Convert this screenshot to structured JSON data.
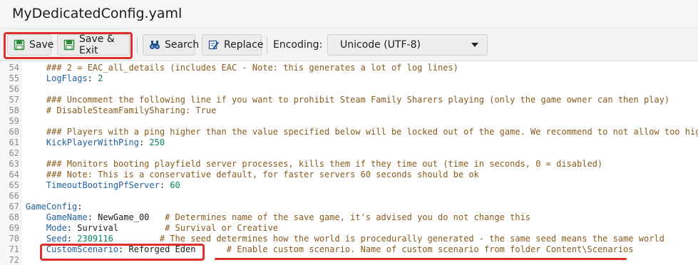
{
  "window": {
    "title": "MyDedicatedConfig.yaml"
  },
  "toolbar": {
    "save_label": "Save",
    "save_exit_label": "Save & Exit",
    "search_label": "Search",
    "replace_label": "Replace",
    "encoding_label": "Encoding:",
    "encoding_value": "Unicode (UTF-8)"
  },
  "colors": {
    "highlight": "#e0302e",
    "key": "#1f5f9f",
    "comment": "#8a5a1e",
    "number": "#098658"
  },
  "lines": [
    {
      "num": "54",
      "parts": [
        {
          "t": "    ### 2 = EAC_all_details (includes EAC - Note: this generates a lot of log lines)",
          "cls": "c"
        }
      ]
    },
    {
      "num": "55",
      "parts": [
        {
          "t": "    LogFlags",
          "cls": "k"
        },
        {
          "t": ": ",
          "cls": "s"
        },
        {
          "t": "2",
          "cls": "v"
        }
      ]
    },
    {
      "num": "56",
      "parts": []
    },
    {
      "num": "57",
      "parts": [
        {
          "t": "    ### Uncomment the following line if you want to prohibit Steam Family Sharers playing (only the game owner can then play)",
          "cls": "c"
        }
      ]
    },
    {
      "num": "58",
      "parts": [
        {
          "t": "    # DisableSteamFamilySharing: True",
          "cls": "c"
        }
      ]
    },
    {
      "num": "59",
      "parts": []
    },
    {
      "num": "60",
      "parts": [
        {
          "t": "    ### Players with a ping higher than the value specified below will be locked out of the game. We recommend to not allow too high",
          "cls": "c"
        }
      ]
    },
    {
      "num": "61",
      "parts": [
        {
          "t": "    KickPlayerWithPing",
          "cls": "k"
        },
        {
          "t": ": ",
          "cls": "s"
        },
        {
          "t": "250",
          "cls": "v"
        }
      ]
    },
    {
      "num": "62",
      "parts": []
    },
    {
      "num": "63",
      "parts": [
        {
          "t": "    ### Monitors booting playfield server processes, kills them if they time out (time in seconds, 0 = disabled)",
          "cls": "c"
        }
      ]
    },
    {
      "num": "64",
      "parts": [
        {
          "t": "    ### Note: This is a conservative default, for faster servers 60 seconds should be ok",
          "cls": "c"
        }
      ]
    },
    {
      "num": "65",
      "parts": [
        {
          "t": "    TimeoutBootingPfServer",
          "cls": "k"
        },
        {
          "t": ": ",
          "cls": "s"
        },
        {
          "t": "60",
          "cls": "v"
        }
      ]
    },
    {
      "num": "66",
      "parts": []
    },
    {
      "num": "67",
      "parts": [
        {
          "t": "GameConfig",
          "cls": "k"
        },
        {
          "t": ":",
          "cls": "s"
        }
      ]
    },
    {
      "num": "68",
      "parts": [
        {
          "t": "    GameName",
          "cls": "k"
        },
        {
          "t": ": NewGame_00   ",
          "cls": "s"
        },
        {
          "t": "# Determines name of the save game, it's advised you do not change this",
          "cls": "c"
        }
      ]
    },
    {
      "num": "69",
      "parts": [
        {
          "t": "    Mode",
          "cls": "k"
        },
        {
          "t": ": Survival         ",
          "cls": "s"
        },
        {
          "t": "# Survival or Creative",
          "cls": "c"
        }
      ]
    },
    {
      "num": "70",
      "parts": [
        {
          "t": "    Seed",
          "cls": "k"
        },
        {
          "t": ": ",
          "cls": "s"
        },
        {
          "t": "2309116",
          "cls": "v"
        },
        {
          "t": "         ",
          "cls": "s"
        },
        {
          "t": "# The seed determines how the world is procedurally generated - the same seed means the same world",
          "cls": "c"
        }
      ]
    },
    {
      "num": "71",
      "parts": [
        {
          "t": "    CustomScenario",
          "cls": "k"
        },
        {
          "t": ": Reforged Eden      ",
          "cls": "s"
        },
        {
          "t": "# Enable custom scenario. Name of custom scenario from folder Content\\Scenarios",
          "cls": "c"
        }
      ]
    },
    {
      "num": "72",
      "parts": []
    }
  ]
}
